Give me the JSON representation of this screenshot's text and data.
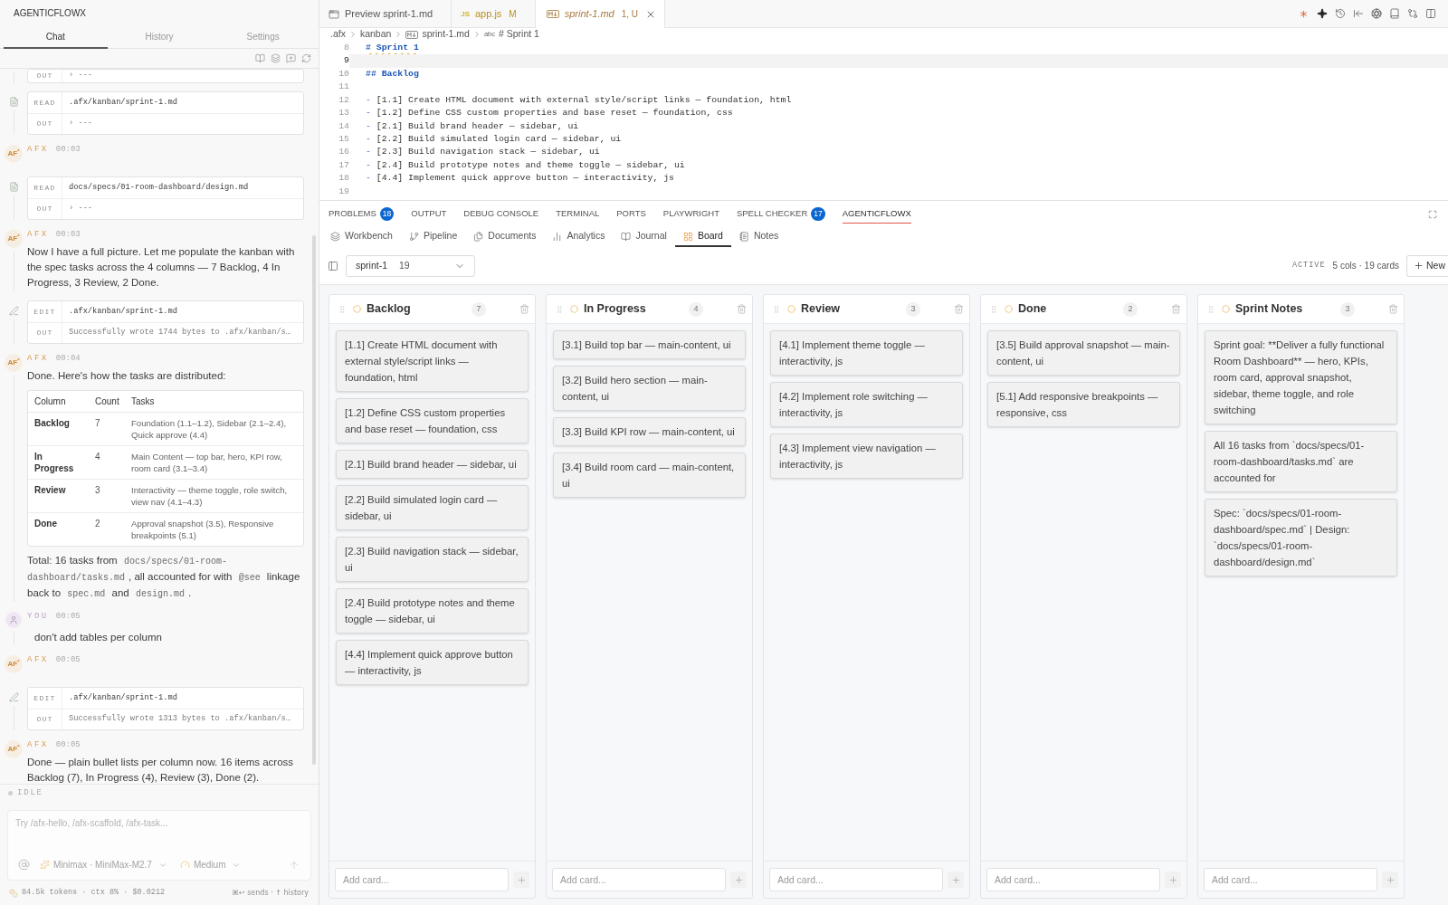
{
  "sidebar": {
    "title": "AGENTICFLOWX",
    "tabs": [
      {
        "label": "Chat",
        "selected": true
      },
      {
        "label": "History",
        "selected": false
      },
      {
        "label": "Settings",
        "selected": false
      }
    ],
    "log": [
      {
        "kind": "output",
        "rows": [
          {
            "label": "OUT",
            "value": "› ---"
          }
        ]
      },
      {
        "kind": "read",
        "rows": [
          {
            "label": "READ",
            "value": ".afx/kanban/sprint-1.md"
          },
          {
            "label": "OUT",
            "value": "› ---"
          }
        ]
      },
      {
        "kind": "agent",
        "avatar": "AF$^{*}$",
        "name": "AFX",
        "time": "00:03"
      },
      {
        "kind": "read",
        "rows": [
          {
            "label": "READ",
            "value": "docs/specs/01-room-dashboard/design.md"
          },
          {
            "label": "OUT",
            "value": "› ---"
          }
        ]
      },
      {
        "kind": "agent",
        "avatar": "AF$^{*}$",
        "name": "AFX",
        "time": "00:03",
        "body": [
          {
            "kind": "paragraph",
            "parts": [
              {
                "kind": "text",
                "text": "Now I have a full picture. Let me populate the kanban with the spec tasks across the 4 columns — 7 Backlog, 4 In Progress, 3 Review, 2 Done."
              }
            ]
          }
        ]
      },
      {
        "kind": "edit",
        "rows": [
          {
            "label": "EDIT",
            "value": ".afx/kanban/sprint-1.md"
          },
          {
            "label": "OUT",
            "value": "Successfully wrote 1744 bytes to .afx/kanban/s…"
          }
        ]
      },
      {
        "kind": "agent",
        "avatar": "AF$^{*}$",
        "name": "AFX",
        "time": "00:04",
        "body": [
          {
            "kind": "paragraph",
            "parts": [
              {
                "kind": "text",
                "text": "Done. Here's how the tasks are distributed:"
              }
            ]
          },
          {
            "kind": "table",
            "columns": [
              "Column",
              "Count",
              "Tasks"
            ],
            "rows": [
              [
                "Backlog",
                "7",
                "Foundation (1.1–1.2), Sidebar (2.1–2.4), Quick approve (4.4)"
              ],
              [
                "In Progress",
                "4",
                "Main Content — top bar, hero, KPI row, room card (3.1–3.4)"
              ],
              [
                "Review",
                "3",
                "Interactivity — theme toggle, role switch, view nav (4.1–4.3)"
              ],
              [
                "Done",
                "2",
                "Approval snapshot (3.5), Responsive breakpoints (5.1)"
              ]
            ]
          },
          {
            "kind": "paragraph",
            "parts": [
              {
                "kind": "text",
                "text": "Total: 16 tasks from "
              },
              {
                "kind": "code",
                "text": "docs/specs/01-room-dashboard/tasks.md"
              },
              {
                "kind": "text",
                "text": ", all accounted for with "
              },
              {
                "kind": "code",
                "text": "@see"
              },
              {
                "kind": "text",
                "text": " linkage back to "
              },
              {
                "kind": "code",
                "text": "spec.md"
              },
              {
                "kind": "text",
                "text": " and "
              },
              {
                "kind": "code",
                "text": "design.md"
              },
              {
                "kind": "text",
                "text": "."
              }
            ]
          }
        ]
      },
      {
        "kind": "user",
        "name": "YOU",
        "time": "00:05",
        "body": [
          {
            "kind": "paragraph",
            "parts": [
              {
                "kind": "text",
                "text": "don't add tables per column"
              }
            ]
          }
        ]
      },
      {
        "kind": "agent",
        "avatar": "AF$^{*}$",
        "name": "AFX",
        "time": "00:05"
      },
      {
        "kind": "edit",
        "rows": [
          {
            "label": "EDIT",
            "value": ".afx/kanban/sprint-1.md"
          },
          {
            "label": "OUT",
            "value": "Successfully wrote 1313 bytes to .afx/kanban/s…"
          }
        ]
      },
      {
        "kind": "agent",
        "avatar": "AF$^{*}$",
        "name": "AFX",
        "time": "00:05",
        "body": [
          {
            "kind": "paragraph",
            "parts": [
              {
                "kind": "text",
                "text": "Done — plain bullet lists per column now. 16 items across Backlog (7), In Progress (4), Review (3), Done (2)."
              }
            ]
          }
        ]
      }
    ],
    "status": "IDLE",
    "composer": {
      "placeholder": "Try /afx-hello, /afx-scaffold, /afx-task...",
      "model": "Minimax · MiniMax-M2.7",
      "effort": "Medium",
      "send_disabled": true
    },
    "usage": "84.5k tokens · ctx 8% · $0.0212",
    "hint": "⌘↩ sends · ↑ history"
  },
  "editor": {
    "tabs": [
      {
        "kind": "preview",
        "label": "Preview sprint-1.md",
        "preview": false,
        "selected": false
      },
      {
        "kind": "script",
        "icon_text": "JS",
        "label": "app.js",
        "status": "M",
        "color": "#b8901f",
        "preview": false,
        "selected": false
      },
      {
        "kind": "markdown",
        "label": "sprint-1.md",
        "status": "1, U",
        "color": "#a9793a",
        "preview": true,
        "selected": true
      }
    ],
    "breadcrumb": [
      {
        "kind": "folder",
        "label": ".afx"
      },
      {
        "kind": "folder",
        "label": "kanban"
      },
      {
        "kind": "file",
        "label": "sprint-1.md"
      },
      {
        "kind": "symbol",
        "icon_text": "abc",
        "label": "# Sprint 1"
      }
    ],
    "lines": [
      {
        "number": "8",
        "kind": "heading",
        "text": "# Sprint 1",
        "flagged": true,
        "current": false
      },
      {
        "number": "9",
        "kind": "blank",
        "flagged": false,
        "current": true
      },
      {
        "number": "10",
        "kind": "heading",
        "text": "## Backlog",
        "flagged": false,
        "current": false
      },
      {
        "number": "11",
        "kind": "blank",
        "flagged": false,
        "current": false
      },
      {
        "number": "12",
        "kind": "item",
        "marker": "-",
        "text": "[1.1] Create HTML document with external style/script links — foundation, html",
        "flagged": false,
        "current": false
      },
      {
        "number": "13",
        "kind": "item",
        "marker": "-",
        "text": "[1.2] Define CSS custom properties and base reset — foundation, css",
        "flagged": false,
        "current": false
      },
      {
        "number": "14",
        "kind": "item",
        "marker": "-",
        "text": "[2.1] Build brand header — sidebar, ui",
        "flagged": false,
        "current": false
      },
      {
        "number": "15",
        "kind": "item",
        "marker": "-",
        "text": "[2.2] Build simulated login card — sidebar, ui",
        "flagged": false,
        "current": false
      },
      {
        "number": "16",
        "kind": "item",
        "marker": "-",
        "text": "[2.3] Build navigation stack — sidebar, ui",
        "flagged": false,
        "current": false
      },
      {
        "number": "17",
        "kind": "item",
        "marker": "-",
        "text": "[2.4] Build prototype notes and theme toggle — sidebar, ui",
        "flagged": false,
        "current": false
      },
      {
        "number": "18",
        "kind": "item",
        "marker": "-",
        "text": "[4.4] Implement quick approve button — interactivity, js",
        "flagged": false,
        "current": false
      },
      {
        "number": "19",
        "kind": "blank",
        "flagged": false,
        "current": false
      }
    ]
  },
  "panel": {
    "tabs": [
      {
        "label": "PROBLEMS",
        "badge": "18",
        "selected": false
      },
      {
        "label": "OUTPUT",
        "selected": false
      },
      {
        "label": "DEBUG CONSOLE",
        "selected": false
      },
      {
        "label": "TERMINAL",
        "selected": false
      },
      {
        "label": "PORTS",
        "selected": false
      },
      {
        "label": "PLAYWRIGHT",
        "selected": false
      },
      {
        "label": "SPELL CHECKER",
        "badge": "17",
        "selected": false
      },
      {
        "label": "AGENTICFLOWX",
        "selected": true
      }
    ]
  },
  "board": {
    "views": [
      {
        "label": "Workbench",
        "selected": false
      },
      {
        "label": "Pipeline",
        "selected": false
      },
      {
        "label": "Documents",
        "selected": false
      },
      {
        "label": "Analytics",
        "selected": false
      },
      {
        "label": "Journal",
        "selected": false
      },
      {
        "label": "Board",
        "selected": true
      },
      {
        "label": "Notes",
        "selected": false
      }
    ],
    "sprint": {
      "value": "sprint-1",
      "count": "19"
    },
    "status": "ACTIVE",
    "summary": "5 cols · 19 cards",
    "new_label": "New",
    "columns": [
      {
        "title": "Backlog",
        "count": "7",
        "placeholder": "Add card...",
        "cards": [
          "[1.1] Create HTML document with external style/script links — foundation, html",
          "[1.2] Define CSS custom properties and base reset — foundation, css",
          "[2.1] Build brand header — sidebar, ui",
          "[2.2] Build simulated login card — sidebar, ui",
          "[2.3] Build navigation stack — sidebar, ui",
          "[2.4] Build prototype notes and theme toggle — sidebar, ui",
          "[4.4] Implement quick approve button — interactivity, js"
        ]
      },
      {
        "title": "In Progress",
        "count": "4",
        "placeholder": "Add card...",
        "cards": [
          "[3.1] Build top bar — main-content, ui",
          "[3.2] Build hero section — main-content, ui",
          "[3.3] Build KPI row — main-content, ui",
          "[3.4] Build room card — main-content, ui"
        ]
      },
      {
        "title": "Review",
        "count": "3",
        "placeholder": "Add card...",
        "cards": [
          "[4.1] Implement theme toggle — interactivity, js",
          "[4.2] Implement role switching — interactivity, js",
          "[4.3] Implement view navigation — interactivity, js"
        ]
      },
      {
        "title": "Done",
        "count": "2",
        "placeholder": "Add card...",
        "cards": [
          "[3.5] Build approval snapshot — main-content, ui",
          "[5.1] Add responsive breakpoints — responsive, css"
        ]
      },
      {
        "title": "Sprint Notes",
        "count": "3",
        "placeholder": "Add card...",
        "cards": [
          "Sprint goal: **Deliver a fully functional Room Dashboard** — hero, KPIs, room card, approval snapshot, sidebar, theme toggle, and role switching",
          "All 16 tasks from `docs/specs/01-room-dashboard/tasks.md` are accounted for",
          "Spec: `docs/specs/01-room-dashboard/spec.md` | Design: `docs/specs/01-room-dashboard/design.md`"
        ]
      }
    ]
  }
}
